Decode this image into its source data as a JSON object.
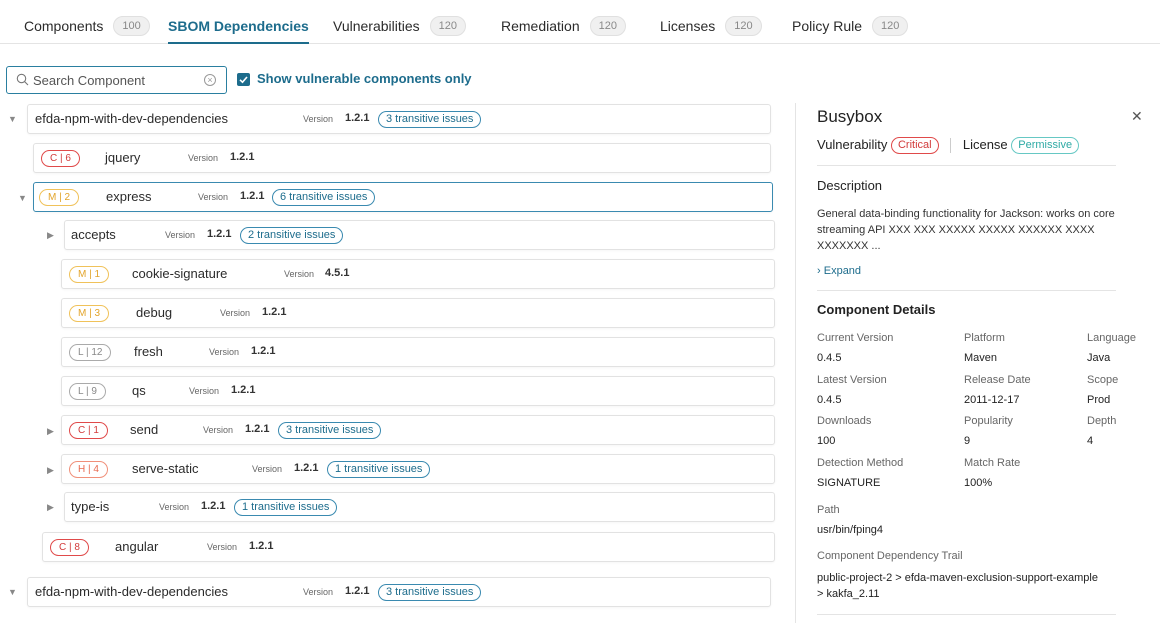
{
  "tabs": [
    {
      "label": "Components",
      "count": "100"
    },
    {
      "label": "SBOM Dependencies",
      "count": ""
    },
    {
      "label": "Vulnerabilities",
      "count": "120"
    },
    {
      "label": "Remediation",
      "count": "120"
    },
    {
      "label": "Licenses",
      "count": "120"
    },
    {
      "label": "Policy Rule",
      "count": "120"
    }
  ],
  "search": {
    "placeholder": "Search Component",
    "checkbox_label": "Show vulnerable components only"
  },
  "tree": {
    "version_label": "Version",
    "rows": [
      {
        "name": "efda-npm-with-dev-dependencies",
        "version": "1.2.1",
        "badge": "",
        "transitive": "3 transitive issues"
      },
      {
        "name": "jquery",
        "version": "1.2.1",
        "badge": "C | 6",
        "transitive": ""
      },
      {
        "name": "express",
        "version": "1.2.1",
        "badge": "M | 2",
        "transitive": "6 transitive issues"
      },
      {
        "name": "accepts",
        "version": "1.2.1",
        "badge": "",
        "transitive": "2 transitive issues"
      },
      {
        "name": "cookie-signature",
        "version": "4.5.1",
        "badge": "M | 1",
        "transitive": ""
      },
      {
        "name": "debug",
        "version": "1.2.1",
        "badge": "M | 3",
        "transitive": ""
      },
      {
        "name": "fresh",
        "version": "1.2.1",
        "badge": "L | 12",
        "transitive": ""
      },
      {
        "name": "qs",
        "version": "1.2.1",
        "badge": "L | 9",
        "transitive": ""
      },
      {
        "name": "send",
        "version": "1.2.1",
        "badge": "C | 1",
        "transitive": "3 transitive issues"
      },
      {
        "name": "serve-static",
        "version": "1.2.1",
        "badge": "H | 4",
        "transitive": "1 transitive issues"
      },
      {
        "name": "type-is",
        "version": "1.2.1",
        "badge": "",
        "transitive": "1 transitive issues"
      },
      {
        "name": "angular",
        "version": "1.2.1",
        "badge": "C | 8",
        "transitive": ""
      },
      {
        "name": "efda-npm-with-dev-dependencies",
        "version": "1.2.1",
        "badge": "",
        "transitive": "3 transitive issues"
      }
    ]
  },
  "panel": {
    "title": "Busybox",
    "vulnerability_label": "Vulnerability",
    "vulnerability_value": "Critical",
    "license_label": "License",
    "license_value": "Permissive",
    "description_heading": "Description",
    "description_text": "General data-binding functionality for Jackson: works on core streaming API XXX XXX  XXXXX XXXXX XXXXXX XXXX XXXXXXX ...",
    "expand_label": "Expand",
    "details_heading": "Component Details",
    "details": {
      "current_version_label": "Current Version",
      "current_version": "0.4.5",
      "platform_label": "Platform",
      "platform": "Maven",
      "language_label": "Language",
      "language": "Java",
      "latest_version_label": "Latest Version",
      "latest_version": "0.4.5",
      "release_date_label": "Release Date",
      "release_date": "2011-12-17",
      "scope_label": "Scope",
      "scope": "Prod",
      "downloads_label": "Downloads",
      "downloads": "100",
      "popularity_label": "Popularity",
      "popularity": "9",
      "depth_label": "Depth",
      "depth": "4",
      "detection_method_label": "Detection Method",
      "detection_method": "SIGNATURE",
      "match_rate_label": "Match Rate",
      "match_rate": "100%"
    },
    "path_label": "Path",
    "path": "usr/bin/fping4",
    "trail_label": "Component Dependency Trail",
    "trail": "public-project-2 > efda-maven-exclusion-support-example > kakfa_2.11"
  },
  "colors": {
    "accent": "#1d6c8c",
    "critical": "#d23b3b",
    "medium": "#e2a42a",
    "low": "#888888",
    "high": "#e86a50",
    "permissive": "#2eaaa5"
  }
}
